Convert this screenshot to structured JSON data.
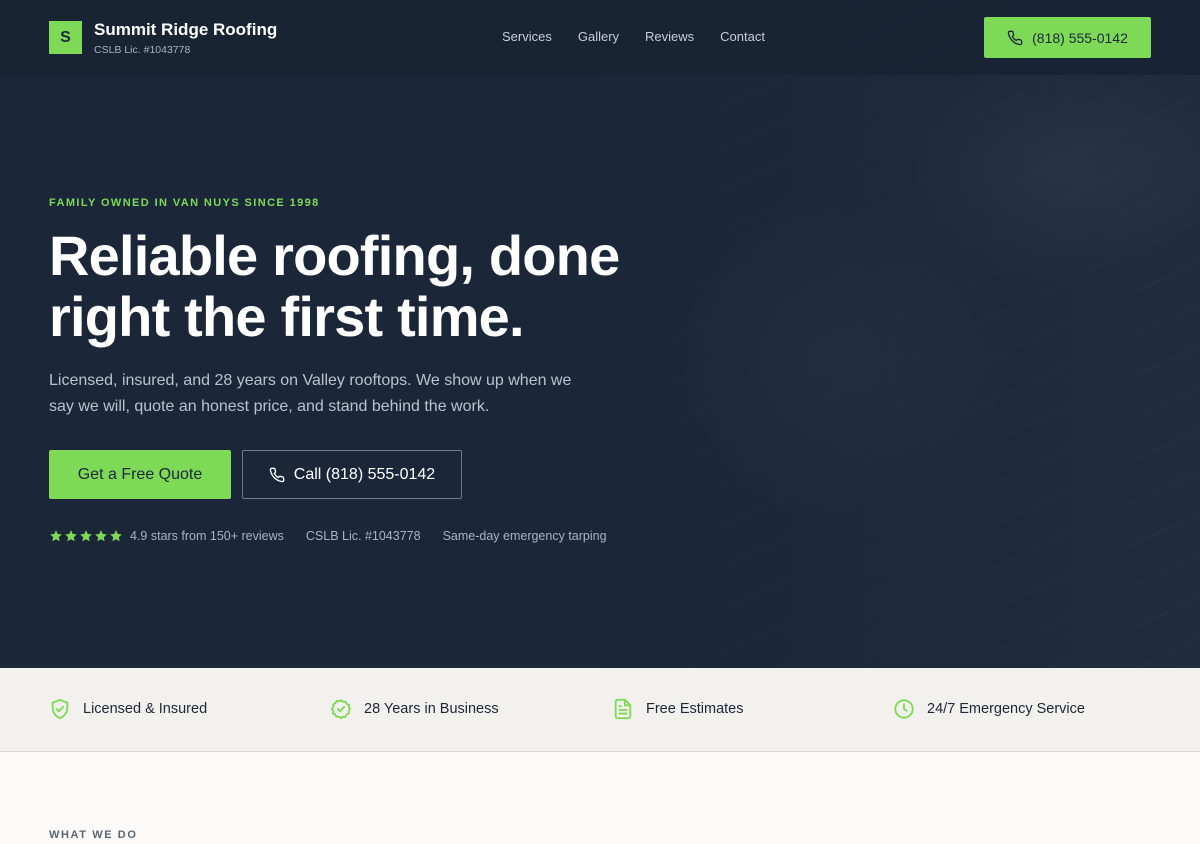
{
  "nav": {
    "logo_letter": "S",
    "brand_name": "Summit Ridge Roofing",
    "license": "CSLB Lic. #1043778",
    "links": [
      "Services",
      "Gallery",
      "Reviews",
      "Contact"
    ],
    "phone": "(818) 555-0142"
  },
  "hero": {
    "eyebrow": "FAMILY OWNED IN VAN NUYS SINCE 1998",
    "headline_line1": "Reliable roofing, done",
    "headline_line2": "right the first time.",
    "lede": "Licensed, insured, and 28 years on Valley rooftops. We show up when we say we will, quote an honest price, and stand behind the work.",
    "cta_primary": "Get a Free Quote",
    "cta_call": "Call (818) 555-0142",
    "rating_stars": 5,
    "rating_text": "4.9 stars from 150+ reviews",
    "license_text": "CSLB Lic. #1043778",
    "emergency_text": "Same-day emergency tarping"
  },
  "badges": [
    {
      "label": "Licensed & Insured",
      "icon": "shield-check-icon"
    },
    {
      "label": "28 Years in Business",
      "icon": "badge-check-icon"
    },
    {
      "label": "Free Estimates",
      "icon": "document-icon"
    },
    {
      "label": "24/7 Emergency Service",
      "icon": "clock-icon"
    }
  ],
  "section": {
    "eyebrow": "WHAT WE DO"
  },
  "colors": {
    "accent": "#7ed957",
    "hero_bg": "#1b2739",
    "badge_strip_bg": "#f2f1ee"
  }
}
